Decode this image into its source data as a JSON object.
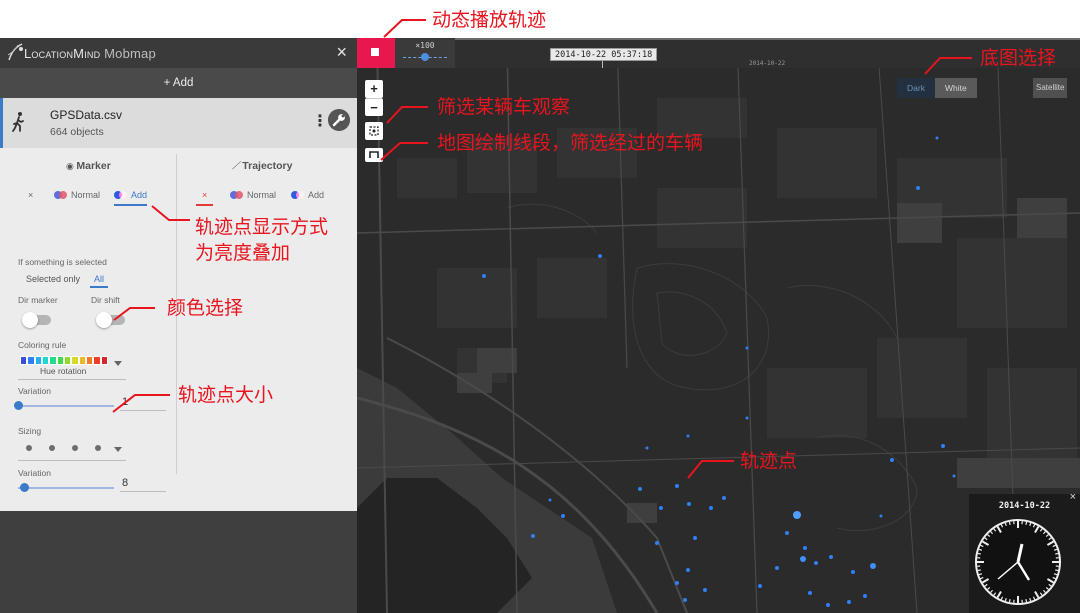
{
  "app": {
    "title_main": "LocationMind",
    "title_sub": "Mobmap",
    "close_glyph": "×"
  },
  "panel": {
    "add_label": "+ Add",
    "layer": {
      "name": "GPSData.csv",
      "count": "664 objects",
      "menu_glyph": "⋮",
      "icon": "walker-icon",
      "accent": "#3b79c9"
    },
    "marker": {
      "title": "Marker",
      "modes": {
        "none": "×",
        "normal": "Normal",
        "add": "Add",
        "selected": "Add"
      },
      "selection_label": "If something is selected",
      "selection_options": {
        "selected_only": "Selected only",
        "all": "All",
        "selected": "All"
      },
      "dir_marker_label": "Dir marker",
      "dir_shift_label": "Dir shift",
      "coloring_rule_label": "Coloring rule",
      "coloring_rule_value": "Hue rotation",
      "hue_colors": [
        "#3a4fd9",
        "#2f7ff0",
        "#22b0f0",
        "#1fd6d0",
        "#27d88e",
        "#3fd94b",
        "#8fdb2e",
        "#d4dc27",
        "#f0b62a",
        "#f27a24",
        "#ec3f25",
        "#d9262b"
      ],
      "color_variation_label": "Variation",
      "color_variation_value": "1",
      "sizing_label": "Sizing",
      "size_variation_label": "Variation",
      "size_variation_value": "8"
    },
    "trajectory": {
      "title": "Trajectory",
      "modes": {
        "none": "×",
        "normal": "Normal",
        "add": "Add",
        "selected": "×"
      }
    }
  },
  "map": {
    "speed_label": "×100",
    "current_time": "2014-10-22 05:37:18",
    "timeline_date": "2014-10-22",
    "zoom_in": "+",
    "zoom_out": "−",
    "basemap": {
      "dark": "Dark",
      "white": "White",
      "satellite": "Satellite",
      "selected": "Dark"
    },
    "clock_date": "2014-10-22",
    "clock_close": "×",
    "accent": "#e8184f",
    "point_color": "#2f7ff6"
  },
  "annotations": {
    "playback": "动态播放轨迹",
    "basemap": "底图选择",
    "filter_vehicle": "筛选某辆车观察",
    "draw_segment": "地图绘制线段，筛选经过的车辆",
    "point_display_line1": "轨迹点显示方式",
    "point_display_line2": "为亮度叠加",
    "color_select": "颜色选择",
    "point_size": "轨迹点大小",
    "track_points": "轨迹点",
    "color": "#e8141e"
  }
}
